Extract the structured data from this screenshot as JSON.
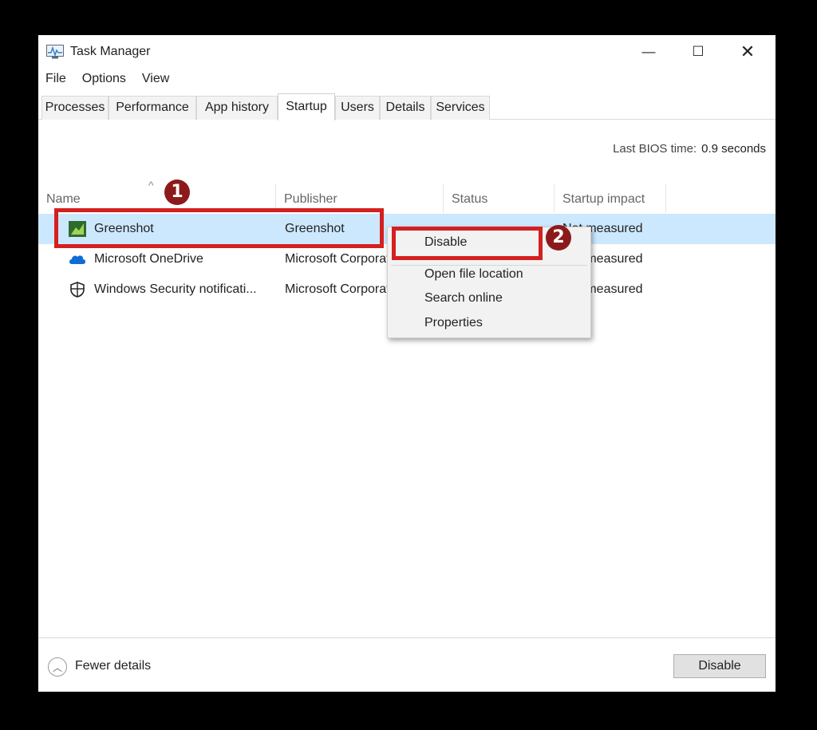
{
  "window": {
    "title": "Task Manager",
    "controls": {
      "minimize": "—",
      "maximize": "☐",
      "close": "✕"
    }
  },
  "menu": [
    "File",
    "Options",
    "View"
  ],
  "tabs": [
    {
      "label": "Processes",
      "active": false
    },
    {
      "label": "Performance",
      "active": false
    },
    {
      "label": "App history",
      "active": false
    },
    {
      "label": "Startup",
      "active": true
    },
    {
      "label": "Users",
      "active": false
    },
    {
      "label": "Details",
      "active": false
    },
    {
      "label": "Services",
      "active": false
    }
  ],
  "bios": {
    "label": "Last BIOS time:",
    "value": "0.9 seconds"
  },
  "columns": {
    "name": "Name",
    "publisher": "Publisher",
    "status": "Status",
    "impact": "Startup impact",
    "sort_indicator": "^"
  },
  "rows": [
    {
      "name": "Greenshot",
      "publisher": "Greenshot",
      "impact": "Not measured",
      "icon": "greenshot-icon",
      "selected": true
    },
    {
      "name": "Microsoft OneDrive",
      "publisher": "Microsoft Corporation",
      "impact": "Not measured",
      "icon": "onedrive-cloud-icon",
      "selected": false
    },
    {
      "name": "Windows Security notificati...",
      "publisher": "Microsoft Corporation",
      "impact": "Not measured",
      "icon": "shield-icon",
      "selected": false
    }
  ],
  "context_menu": [
    "Disable",
    "Open file location",
    "Search online",
    "Properties"
  ],
  "footer": {
    "fewer_details": "Fewer details",
    "disable_button": "Disable"
  },
  "annotations": {
    "marker_1": "1",
    "marker_2": "2"
  },
  "colors": {
    "selection": "#cce8ff",
    "highlight": "#d42020",
    "marker": "#8d1a1a",
    "onedrive": "#0f6cd6",
    "greenshot": "#2f6b2c"
  }
}
